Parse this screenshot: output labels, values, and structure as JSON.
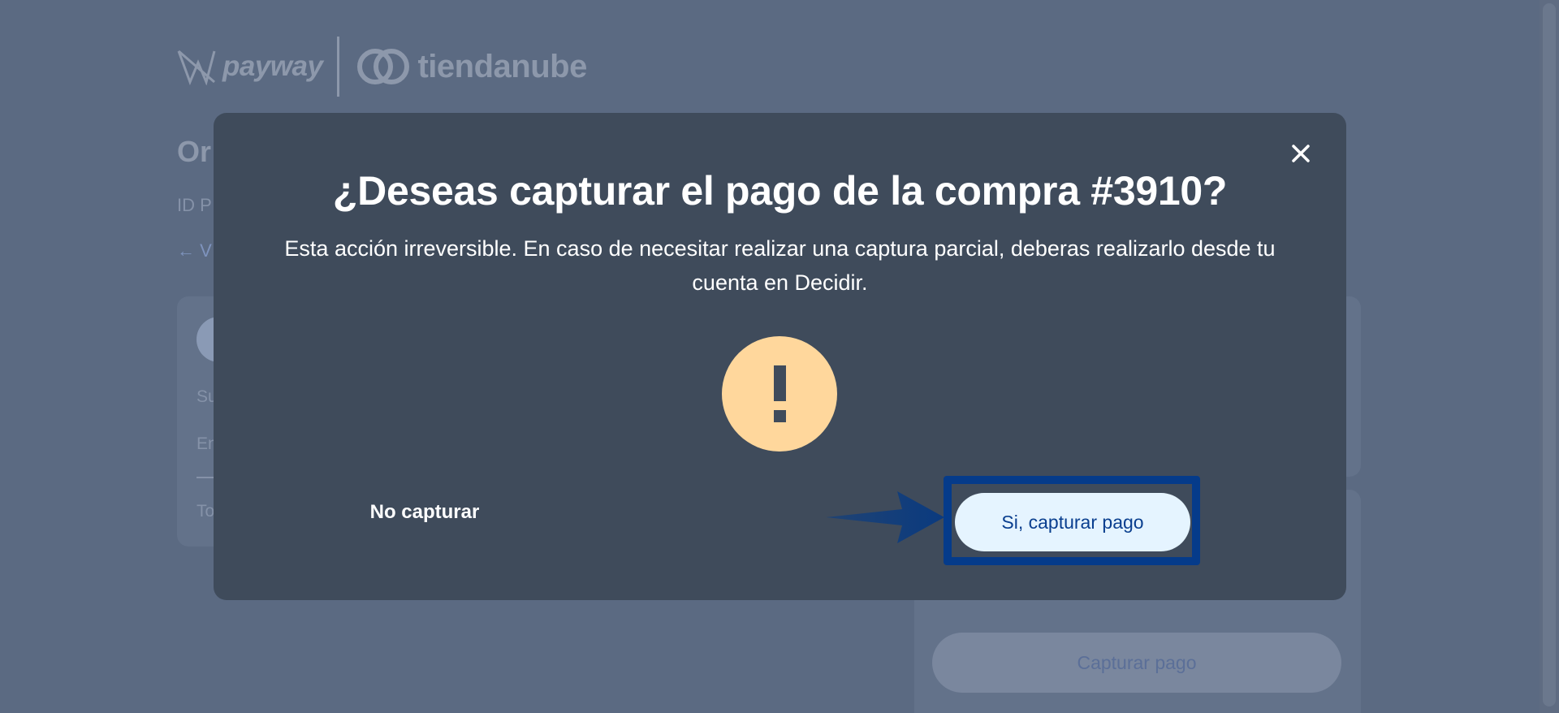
{
  "background": {
    "brand": {
      "payway": "payway",
      "tiendanube": "tiendanube"
    },
    "title": "Or",
    "id_label": "ID P",
    "back_link": "← V",
    "card_lines": [
      "Su",
      "En",
      "To"
    ],
    "disabled_button": "Capturar pago"
  },
  "modal": {
    "title": "¿Deseas capturar el pago de la compra #3910?",
    "body": "Esta acción irreversible. En caso de necesitar realizar una captura parcial, deberas realizarlo desde tu cuenta en Decidir.",
    "icon": "exclamation-icon",
    "cancel_label": "No capturar",
    "confirm_label": "Si, capturar pago"
  },
  "colors": {
    "overlay": "#5b6a82",
    "modal_bg": "#3f4b5b",
    "warning": "#ffd79c",
    "confirm_bg": "#e5f4ff",
    "confirm_text": "#0a3f8f",
    "highlight": "#053b8a"
  }
}
